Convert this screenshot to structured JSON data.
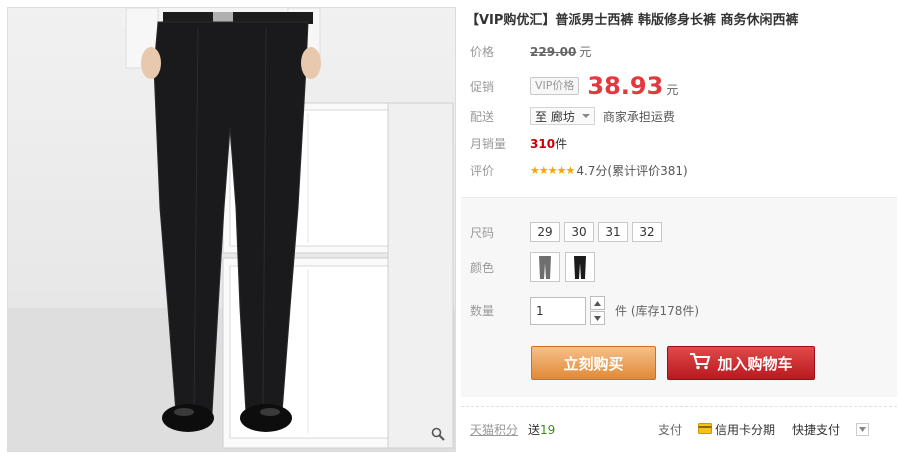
{
  "product": {
    "title": "【VIP购优汇】普派男士西裤 韩版修身长裤 商务休闲西裤"
  },
  "price": {
    "label": "价格",
    "original": "229.00",
    "unit": "元"
  },
  "promo": {
    "label": "促销",
    "tag": "VIP价格",
    "price": "38.93",
    "unit": "元"
  },
  "shipping": {
    "label": "配送",
    "location": "至 廊坊",
    "note": "商家承担运费"
  },
  "sales": {
    "label": "月销量",
    "count": "310",
    "unit": "件"
  },
  "rating": {
    "label": "评价",
    "stars": "★★★★★",
    "text": "4.7分(累计评价381)"
  },
  "options": {
    "size_label": "尺码",
    "sizes": [
      "29",
      "30",
      "31",
      "32"
    ],
    "color_label": "颜色",
    "qty_label": "数量",
    "qty_value": "1",
    "stock_text": "件 (库存178件)"
  },
  "actions": {
    "buy_now": "立刻购买",
    "add_cart": "加入购物车"
  },
  "footer": {
    "points_label": "天猫积分",
    "points_prefix": "送",
    "points_value": "19",
    "pay_label": "支付",
    "credit_label": "信用卡分期",
    "quick_label": "快捷支付"
  },
  "colors": {
    "price_red": "#e4393c",
    "buy_orange": "#e08a36",
    "cart_red": "#b8191f"
  }
}
